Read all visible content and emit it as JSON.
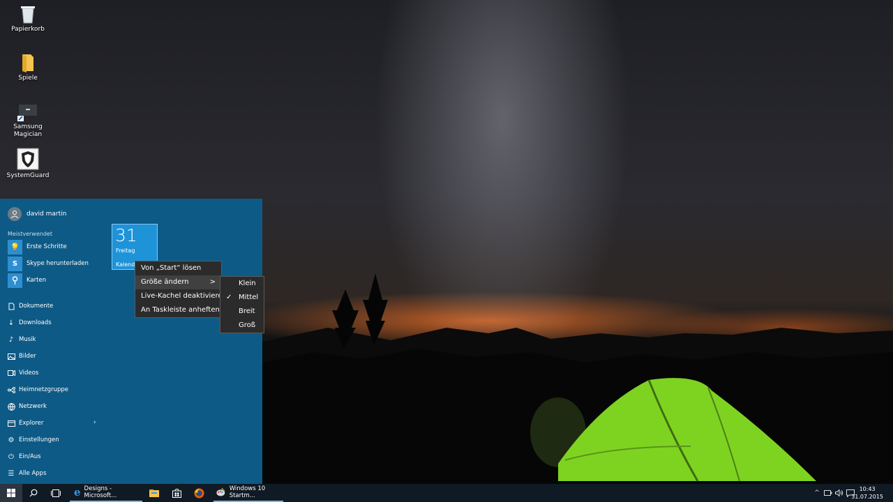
{
  "desktop": {
    "icons": [
      {
        "label": "Papierkorb",
        "icon": "recycle-bin-icon"
      },
      {
        "label": "Spiele",
        "icon": "folder-icon"
      },
      {
        "label": "Samsung Magician",
        "icon": "ssd-icon"
      },
      {
        "label": "SystemGuard",
        "icon": "shield-icon"
      }
    ]
  },
  "start_menu": {
    "user": "david martin",
    "most_used_label": "Meistverwendet",
    "most_used": [
      {
        "label": "Erste Schritte",
        "icon": "lightbulb-icon"
      },
      {
        "label": "Skype herunterladen",
        "icon": "skype-icon"
      },
      {
        "label": "Karten",
        "icon": "maps-icon"
      }
    ],
    "places": [
      {
        "label": "Dokumente",
        "icon": "document-icon"
      },
      {
        "label": "Downloads",
        "icon": "download-icon"
      },
      {
        "label": "Musik",
        "icon": "music-icon"
      },
      {
        "label": "Bilder",
        "icon": "pictures-icon"
      },
      {
        "label": "Videos",
        "icon": "video-icon"
      },
      {
        "label": "Heimnetzgruppe",
        "icon": "homegroup-icon"
      },
      {
        "label": "Netzwerk",
        "icon": "network-icon"
      },
      {
        "label": "Explorer",
        "icon": "explorer-icon"
      },
      {
        "label": "Einstellungen",
        "icon": "gear-icon"
      },
      {
        "label": "Ein/Aus",
        "icon": "power-icon"
      },
      {
        "label": "Alle Apps",
        "icon": "all-apps-icon"
      }
    ],
    "tile": {
      "number": "31",
      "day": "Freitag",
      "app": "Kalender"
    }
  },
  "context_menu": {
    "items": [
      "Von „Start“ lösen",
      "Größe ändern",
      "Live-Kachel deaktivieren",
      "An Taskleiste anheften"
    ],
    "submenu_arrow": ">"
  },
  "size_submenu": {
    "items": [
      "Klein",
      "Mittel",
      "Breit",
      "Groß"
    ],
    "selected": "Mittel",
    "check": "✓"
  },
  "taskbar": {
    "apps": [
      {
        "label": "Designs - Microsoft...",
        "icon": "edge-icon"
      },
      {
        "label": "",
        "icon": "file-explorer-icon"
      },
      {
        "label": "",
        "icon": "store-icon"
      },
      {
        "label": "",
        "icon": "firefox-icon"
      },
      {
        "label": "Windows 10 Startm...",
        "icon": "paint-icon"
      }
    ],
    "time": "10:43",
    "date": "31.07.2015"
  },
  "colors": {
    "start_bg": "#0e5a86",
    "tile_bg": "#1e93d8",
    "taskbar_bg": "#101a24",
    "menu_bg": "#2b2b2b"
  }
}
